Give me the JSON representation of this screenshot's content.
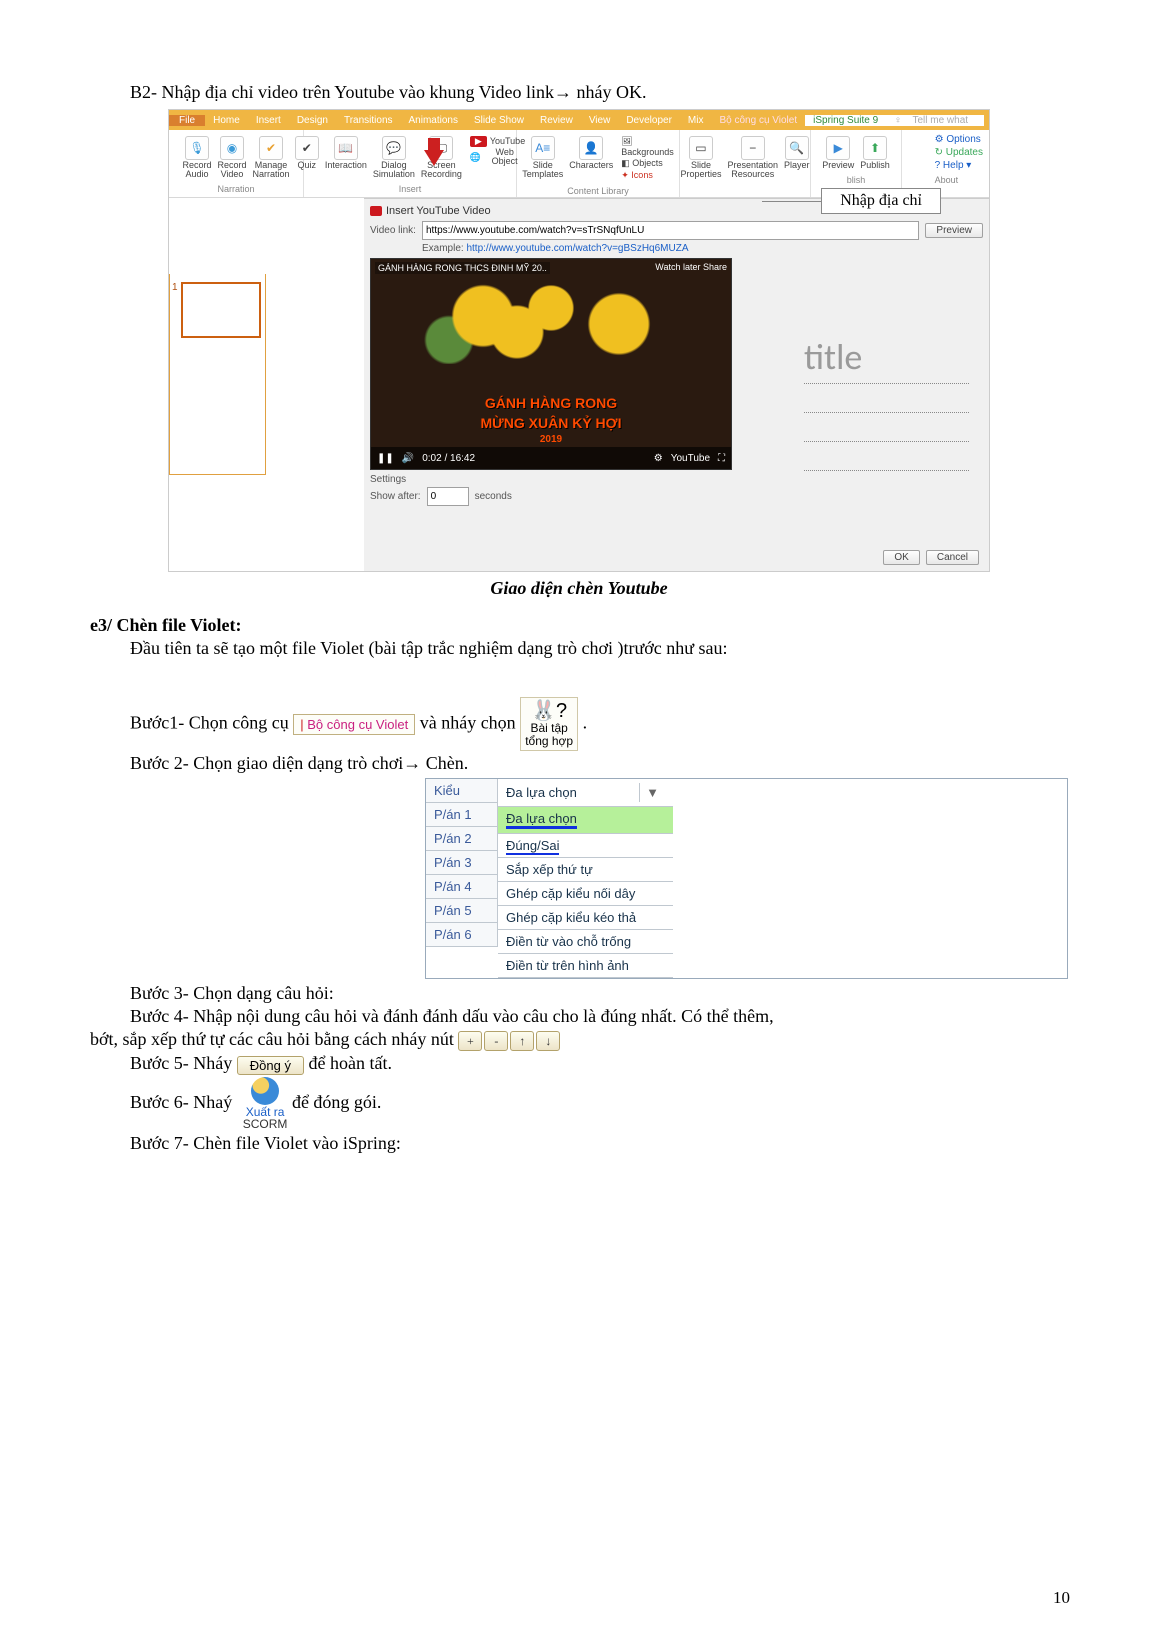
{
  "b2_heading": "B2- Nhập địa chỉ video trên Youtube vào khung Video link",
  "b2_tail": " nháy OK.",
  "ribbon": {
    "tabs": [
      "File",
      "Home",
      "Insert",
      "Design",
      "Transitions",
      "Animations",
      "Slide Show",
      "Review",
      "View",
      "Developer",
      "Mix",
      "Bộ công cụ Violet",
      "iSpring Suite 9",
      "Tell me what"
    ],
    "groups": {
      "narration": {
        "items": [
          "Record Audio",
          "Record Video",
          "Manage Narration"
        ],
        "label": "Narration"
      },
      "insert": {
        "items": [
          "Quiz",
          "Interaction",
          "Dialog Simulation",
          "Screen Recording",
          "YouTube",
          "Web Object"
        ],
        "label": "Insert"
      },
      "content": {
        "items": [
          "Slide Templates",
          "Characters",
          "Backgrounds",
          "Objects",
          "Icons"
        ],
        "label": "Content Library"
      },
      "pres": {
        "items": [
          "Slide Properties",
          "Presentation Resources",
          "Player"
        ],
        "label": ""
      },
      "publish": {
        "items": [
          "Preview",
          "Publish"
        ],
        "label": "blish"
      },
      "about": {
        "items": [
          "Options",
          "Updates",
          "Help"
        ],
        "label": "About"
      }
    }
  },
  "callout": "Nhập địa chỉ",
  "dlg": {
    "title": "Insert YouTube Video",
    "link_label": "Video link:",
    "link_value": "https://www.youtube.com/watch?v=sTrSNqfUnLU",
    "preview_btn": "Preview",
    "example_label": "Example:  ",
    "example_url": "http://www.youtube.com/watch?v=gBSzHq6MUZA",
    "settings": "Settings",
    "show_after": "Show after:",
    "show_after_val": "0",
    "seconds": "seconds",
    "ok": "OK",
    "cancel": "Cancel"
  },
  "preview": {
    "topline": "GÁNH HÀNG RONG THCS ĐINH MỸ 20..",
    "watch": "Watch later    Share",
    "l1": "GÁNH HÀNG RONG",
    "l2": "MỪNG XUÂN KỶ HỢI",
    "l3": "2019",
    "time": "0:02 / 16:42",
    "ytlabel": "YouTube"
  },
  "title_placeholder": "title",
  "caption1": "Giao diện chèn Youtube",
  "e3_head": "e3/ Chèn file Violet:",
  "e3_intro": "Đầu tiên ta sẽ tạo một file Violet (bài tập trắc nghiệm dạng trò chơi )trước như sau:",
  "step1_a": "Bước1- Chọn công cụ ",
  "violet_tool": "Bộ công cụ Violet",
  "step1_b": " và nháy chọn ",
  "bunny": {
    "l1": "Bài tập",
    "l2": "tổng hợp",
    "face": "🐰?"
  },
  "step1_c": " .",
  "step2": "Bước 2- Chọn giao diện dạng trò chơi",
  "step2_tail": " Chèn.",
  "kieu": {
    "col1": [
      "Kiểu",
      "P/án 1",
      "P/án 2",
      "P/án 3",
      "P/án 4",
      "P/án 5",
      "P/án 6"
    ],
    "hdr": "Đa lựa chọn",
    "opts": [
      "Đa lựa chọn",
      "Đúng/Sai",
      "Sắp xếp thứ tự",
      "Ghép cặp kiểu nối dây",
      "Ghép cặp kiểu kéo thả",
      "Điền từ vào chỗ trống",
      "Điền từ trên hình ảnh"
    ]
  },
  "step3": "Bước 3- Chọn dạng câu hỏi:",
  "step4a": "Bước 4- Nhập nội dung câu hỏi và đánh đánh dấu vào câu cho là đúng nhất. Có thể thêm,",
  "step4b": "bớt, sắp xếp thứ tự các câu hỏi bằng cách nháy nút ",
  "arrow_btns": [
    "+",
    "-",
    "↑",
    "↓"
  ],
  "step5a": "Bước 5- Nháy ",
  "dongy": "Đồng ý",
  "step5b": " để hoàn tất.",
  "export": {
    "l1": "Xuất ra",
    "l2": "SCORM"
  },
  "step6a": "Bước 6- Nhaý ",
  "step6b": " để đóng gói.",
  "step7": "Bước 7- Chèn file Violet vào iSpring:",
  "pagenum": "10",
  "slide_num": "1"
}
